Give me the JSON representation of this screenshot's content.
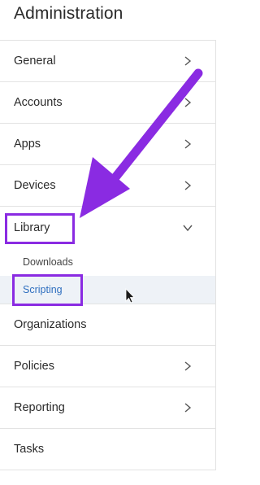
{
  "header": {
    "title": "Administration"
  },
  "nav": {
    "items": [
      {
        "label": "General",
        "chevron": "right"
      },
      {
        "label": "Accounts",
        "chevron": "right"
      },
      {
        "label": "Apps",
        "chevron": "right"
      },
      {
        "label": "Devices",
        "chevron": "right"
      },
      {
        "label": "Library",
        "chevron": "down"
      },
      {
        "label": "Organizations"
      },
      {
        "label": "Policies",
        "chevron": "right"
      },
      {
        "label": "Reporting",
        "chevron": "right"
      },
      {
        "label": "Tasks"
      }
    ],
    "library_sub": [
      {
        "label": "Downloads"
      },
      {
        "label": "Scripting",
        "active": true
      }
    ]
  },
  "annotation": {
    "color": "#8a2be2"
  }
}
